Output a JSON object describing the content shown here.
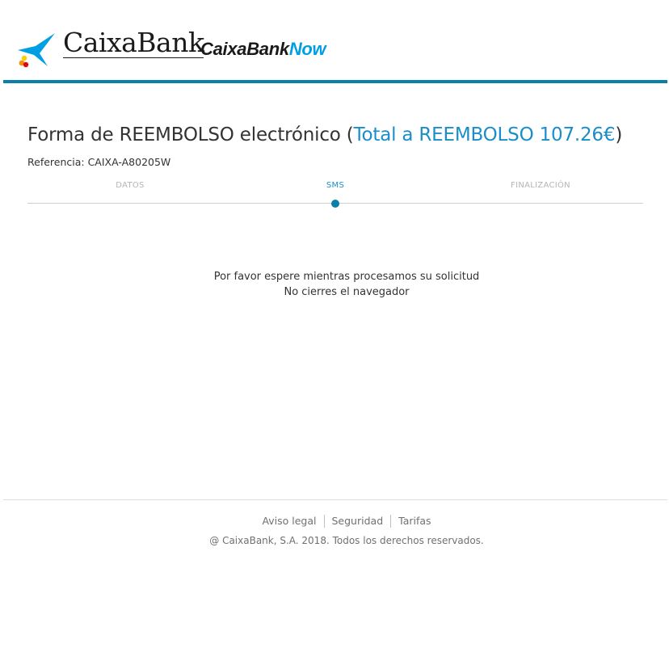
{
  "brand": {
    "name": "CaixaBank",
    "now_part1": "CaixaBank",
    "now_part2": "Now",
    "star_icon": "caixabank-star-icon",
    "accent_color": "#0a7fa8",
    "link_color": "#1b8ec9"
  },
  "page": {
    "title_main": "Forma de REEMBOLSO electrónico",
    "paren_open": " (",
    "title_total": "Total a REEMBOLSO 107.26€",
    "paren_close": ")",
    "reference": "Referencia: CAIXA-A80205W"
  },
  "steps": {
    "items": [
      {
        "label": "DATOS",
        "active": false
      },
      {
        "label": "SMS",
        "active": true
      },
      {
        "label": "FINALIZACIÓN",
        "active": false
      }
    ],
    "current_index": 1
  },
  "message": {
    "line1": "Por favor espere mientras procesamos su solicitud",
    "line2": "No cierres el navegador"
  },
  "footer": {
    "links": [
      "Aviso legal",
      "Seguridad",
      "Tarifas"
    ],
    "copyright": "@ CaixaBank, S.A. 2018. Todos los derechos reservados."
  }
}
